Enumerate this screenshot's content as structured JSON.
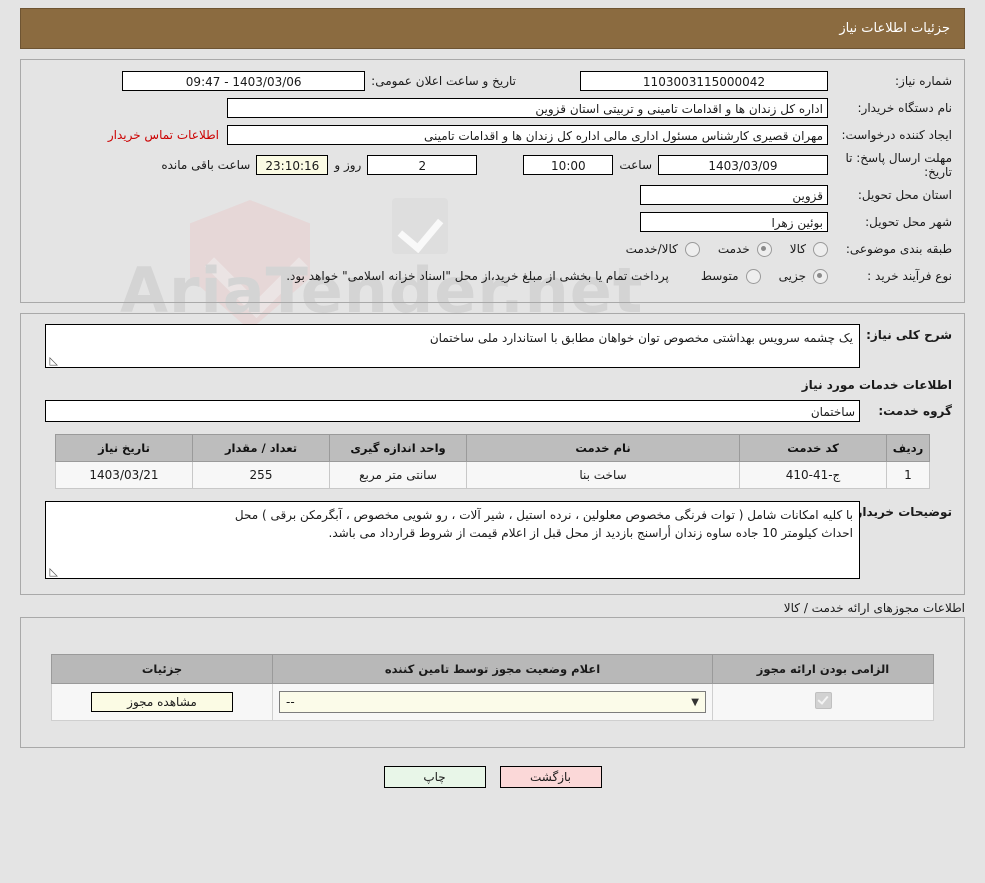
{
  "header": {
    "title": "جزئیات اطلاعات نیاز"
  },
  "watermark": {
    "text": "AriaTender.net"
  },
  "info": {
    "need_number_label": "شماره نیاز:",
    "need_number_value": "1103003115000042",
    "announce_label": "تاریخ و ساعت اعلان عمومی:",
    "announce_value": "1403/03/06 - 09:47",
    "buyer_org_label": "نام دستگاه خریدار:",
    "buyer_org_value": "اداره کل زندان ها و اقدامات تامینی و تربیتی استان قزوین",
    "creator_label": "ایجاد کننده درخواست:",
    "creator_value": "مهران قصیری کارشناس مسئول اداری مالی اداره کل زندان ها و اقدامات تامینی",
    "contact_link": "اطلاعات تماس خریدار",
    "deadline_label": "مهلت ارسال پاسخ: تا تاریخ:",
    "deadline_date": "1403/03/09",
    "hour_label": "ساعت",
    "deadline_time": "10:00",
    "days_value": "2",
    "days_unit": "روز و",
    "countdown": "23:10:16",
    "countdown_suffix": "ساعت باقی مانده",
    "province_label": "استان محل تحویل:",
    "province_value": "قزوین",
    "city_label": "شهر محل تحویل:",
    "city_value": "بوئین زهرا",
    "category_label": "طبقه بندی موضوعی:",
    "category_options": [
      "کالا",
      "خدمت",
      "کالا/خدمت"
    ],
    "category_selected": "خدمت",
    "process_label": "نوع فرآیند خرید :",
    "process_options": [
      "جزیی",
      "متوسط"
    ],
    "process_selected": "جزیی",
    "process_note": "پرداخت تمام یا بخشی از مبلغ خرید،از محل \"اسناد خزانه اسلامی\" خواهد بود."
  },
  "summary": {
    "label": "شرح کلی نیاز:",
    "value": "یک چشمه  سرویس بهداشتی مخصوص توان خواهان مطابق با استاندارد ملی ساختمان"
  },
  "services": {
    "section_title": "اطلاعات خدمات مورد نیاز",
    "group_label": "گروه خدمت:",
    "group_value": "ساختمان",
    "columns": [
      "ردیف",
      "کد خدمت",
      "نام خدمت",
      "واحد اندازه گیری",
      "تعداد / مقدار",
      "تاریخ نیاز"
    ],
    "rows": [
      {
        "index": "1",
        "code": "ج-41-410",
        "name": "ساخت بنا",
        "unit": "سانتی متر مربع",
        "qty": "255",
        "date": "1403/03/21"
      }
    ]
  },
  "buyer_notes": {
    "label": "توضیحات خریدار:",
    "line1": "با کلیه امکانات شامل ( توات فرنگی مخصوص معلولین ، نرده استیل ، شیر آلات ، رو شویی مخصوص ، آبگرمکن برقی ) محل",
    "line2": "احداث کیلومتر 10 جاده ساوه  زندان أراسنج  بازدید از محل قبل از  اعلام قیمت از شروط قرارداد می باشد."
  },
  "permits": {
    "section_label": "اطلاعات مجوزهای ارائه خدمت / کالا",
    "columns": [
      "الزامی بودن ارائه مجوز",
      "اعلام وضعیت مجوز توسط تامین کننده",
      "جزئیات"
    ],
    "rows": [
      {
        "required_checked": true,
        "status_value": "--",
        "details_button": "مشاهده مجوز"
      }
    ]
  },
  "footer": {
    "print_label": "چاپ",
    "back_label": "بازگشت"
  }
}
